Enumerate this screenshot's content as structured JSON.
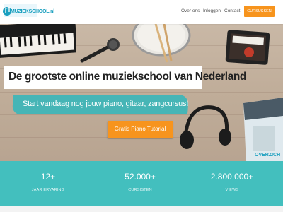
{
  "header": {
    "logo_text": "MUZIEKSCHOOL.nl",
    "nav": [
      "Over ons",
      "Inloggen",
      "Contact"
    ],
    "cta_label": "CURSUSSEN"
  },
  "hero": {
    "title": "De grootste online muziekschool van Nederland",
    "subtitle": "Start vandaag nog jouw piano, gitaar, zangcursus!",
    "button_label": "Gratis Piano Tutorial",
    "book_label": "OVERZICH"
  },
  "stats": [
    {
      "value": "12+",
      "label": "JAAR ERVARING"
    },
    {
      "value": "52.000+",
      "label": "CURSISTEN"
    },
    {
      "value": "2.800.000+",
      "label": "VIEWS"
    }
  ],
  "colors": {
    "accent": "#f7941d",
    "teal": "#43bfbe"
  }
}
